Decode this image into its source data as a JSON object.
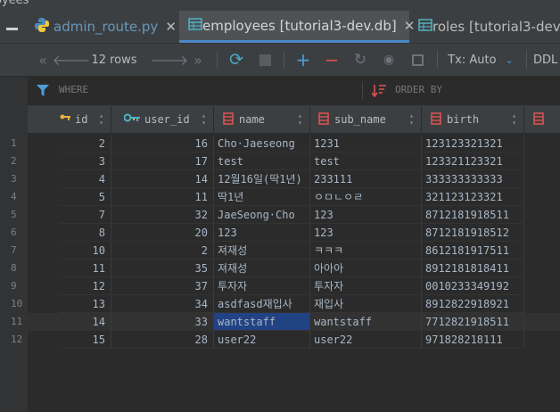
{
  "window": {
    "title_fragment": "oyees"
  },
  "tabs": [
    {
      "label": "admin_route.py",
      "icon": "python-icon",
      "active": false
    },
    {
      "label": "employees [tutorial3-dev.db]",
      "icon": "table-icon",
      "active": true
    },
    {
      "label": "roles [tutorial3-dev.",
      "icon": "table-icon",
      "active": false
    }
  ],
  "toolbar": {
    "rows_label": "12 rows",
    "tx_label": "Tx: Auto",
    "ddl_label": "DDL"
  },
  "filter": {
    "where_label": "WHERE",
    "order_label": "ORDER BY"
  },
  "columns": [
    "id",
    "user_id",
    "name",
    "sub_name",
    "birth"
  ],
  "rows": [
    {
      "n": "1",
      "id": "2",
      "user_id": "16",
      "name": "Cho·Jaeseong",
      "sub_name": "1231",
      "birth": "123123321321"
    },
    {
      "n": "2",
      "id": "3",
      "user_id": "17",
      "name": "test",
      "sub_name": "test",
      "birth": "123321123321"
    },
    {
      "n": "3",
      "id": "4",
      "user_id": "14",
      "name": "12월16일(딱1년)",
      "sub_name": "233111",
      "birth": "333333333333"
    },
    {
      "n": "4",
      "id": "5",
      "user_id": "11",
      "name": "딱1년",
      "sub_name": "ㅇㅁㄴㅇㄹ",
      "birth": "321123123321"
    },
    {
      "n": "5",
      "id": "7",
      "user_id": "32",
      "name": "JaeSeong·Cho",
      "sub_name": "123",
      "birth": "8712181918511"
    },
    {
      "n": "6",
      "id": "8",
      "user_id": "20",
      "name": "123",
      "sub_name": "123",
      "birth": "8712181918512"
    },
    {
      "n": "7",
      "id": "10",
      "user_id": "2",
      "name": "져재성",
      "sub_name": "ㅋㅋㅋ",
      "birth": "8612181917511"
    },
    {
      "n": "8",
      "id": "11",
      "user_id": "35",
      "name": "져재성",
      "sub_name": "아아아",
      "birth": "8912181818411"
    },
    {
      "n": "9",
      "id": "12",
      "user_id": "37",
      "name": "투자자",
      "sub_name": "투자자",
      "birth": "0010233349192"
    },
    {
      "n": "10",
      "id": "13",
      "user_id": "34",
      "name": "asdfasd재입사",
      "sub_name": "재입사",
      "birth": "8912822918921"
    },
    {
      "n": "11",
      "id": "14",
      "user_id": "33",
      "name": "wantstaff",
      "sub_name": "wantstaff",
      "birth": "7712821918511"
    },
    {
      "n": "12",
      "id": "15",
      "user_id": "28",
      "name": "user22",
      "sub_name": "user22",
      "birth": "971828218111"
    }
  ],
  "colors": {
    "accent": "#4a88c7",
    "selection": "#214283",
    "key_gold": "#e8b23a",
    "column_red": "#d9534f"
  }
}
